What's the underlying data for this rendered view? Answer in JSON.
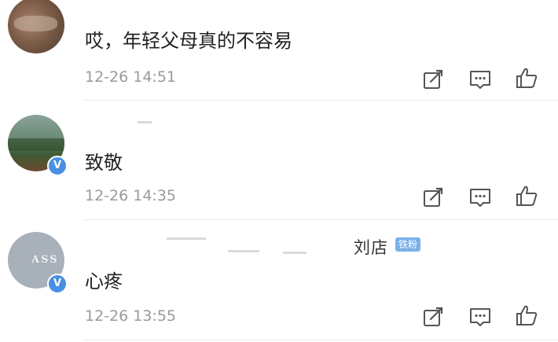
{
  "comments": [
    {
      "username": "",
      "text": "哎，年轻父母真的不容易",
      "time": "12-26 14:51",
      "verified": false,
      "badge": ""
    },
    {
      "username": "",
      "text": "致敬",
      "time": "12-26 14:35",
      "verified": true,
      "badge": ""
    },
    {
      "username": "刘店",
      "text": "心疼",
      "time": "12-26 13:55",
      "verified": true,
      "badge": "铁粉"
    }
  ],
  "avatar_texts": {
    "third": "ASS"
  },
  "icons": {
    "edit": "edit-icon",
    "comment": "comment-icon",
    "like": "like-icon"
  },
  "colors": {
    "verified": "#4a90e2",
    "badge": "#7ab0e8",
    "time": "#9a9a9a"
  }
}
